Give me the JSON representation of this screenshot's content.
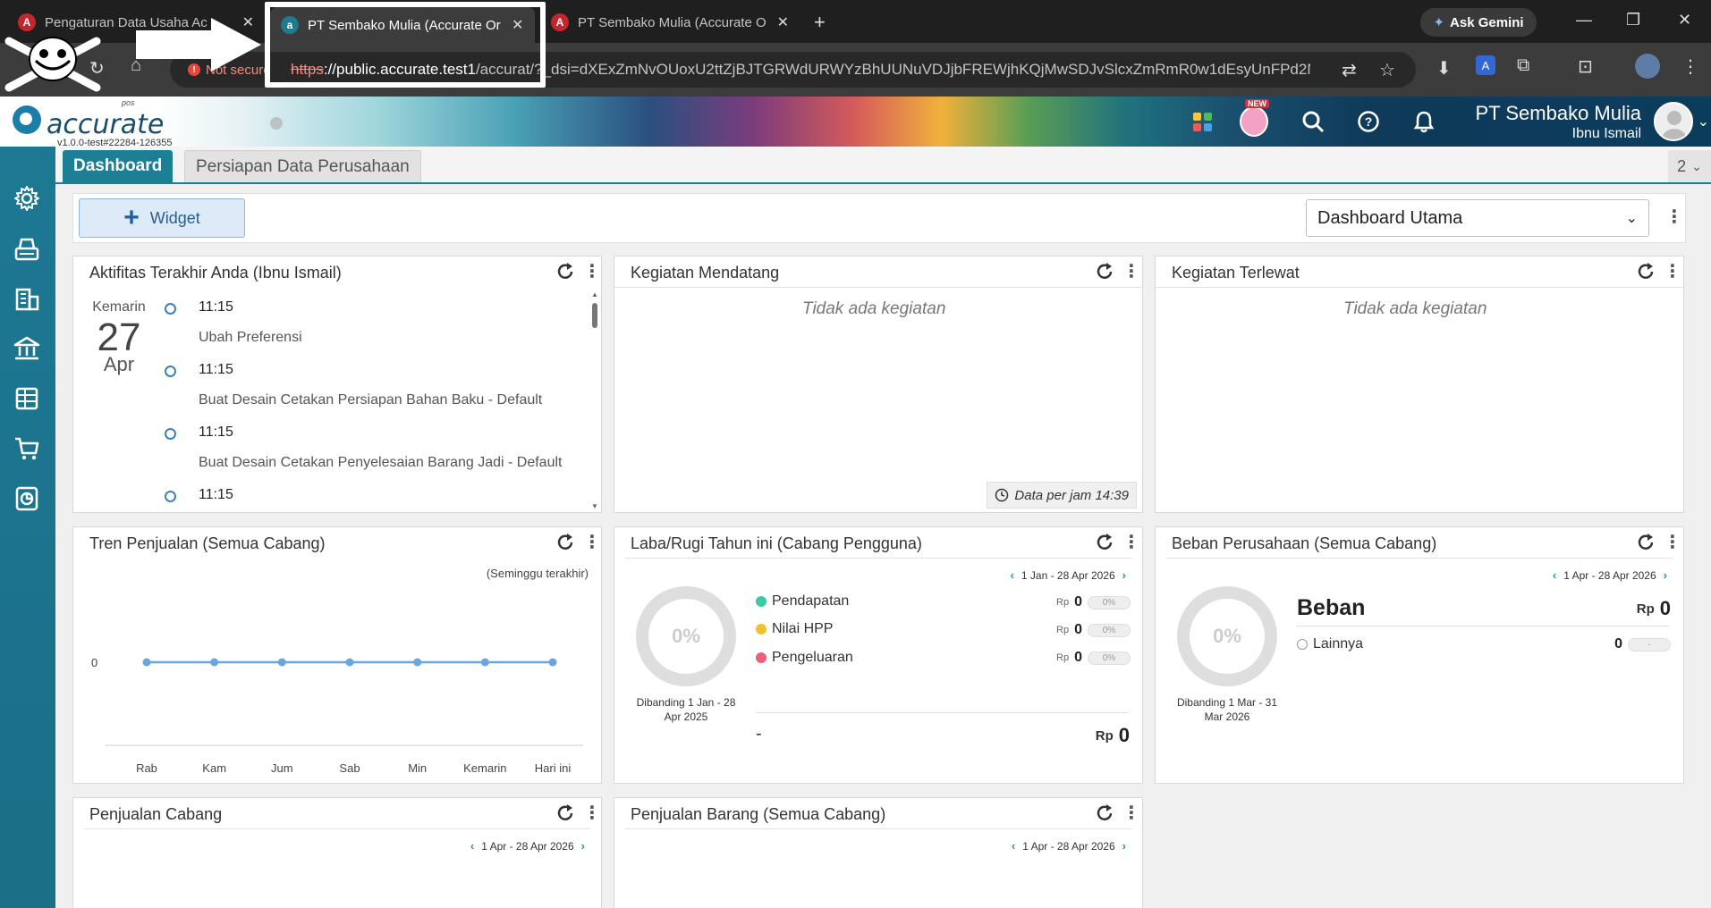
{
  "browser": {
    "tabs": [
      {
        "title": "Pengaturan Data Usaha Ac",
        "active": false
      },
      {
        "title": "PT Sembako Mulia (Accurate Or",
        "active": true
      },
      {
        "title": "PT Sembako Mulia (Accurate O",
        "active": false
      }
    ],
    "new_tab": "+",
    "gemini_label": "Ask Gemini",
    "not_secure": "Not secure",
    "url_scheme": "https",
    "url_host": "://public.accurate.test1",
    "url_rest": "/accurat/?_dsi=dXExZmNvOUoxU2ttZjBJTGRWdURWYzBhUUNuVDJjbFREWjhKQjMwSDJvSlcxZmRmR0w1dEsyUnFPd2Nx..."
  },
  "app": {
    "logo_text": "accurate",
    "logo_pos": "pos",
    "version": "v1.0.0-test#22284-126355",
    "new_badge": "NEW",
    "company_name": "PT Sembako Mulia",
    "user_name": "Ibnu Ismail"
  },
  "tabs": {
    "dashboard": "Dashboard",
    "persiapan": "Persiapan Data Perusahaan",
    "count": "2"
  },
  "toolbar": {
    "widget_label": "Widget",
    "dashboard_select": "Dashboard Utama"
  },
  "activity": {
    "title": "Aktifitas Terakhir Anda (Ibnu Ismail)",
    "day_label": "Kemarin",
    "day_num": "27",
    "month": "Apr",
    "items": [
      {
        "time": "11:15",
        "desc": "Ubah Preferensi"
      },
      {
        "time": "11:15",
        "desc": "Buat Desain Cetakan Persiapan Bahan Baku - Default"
      },
      {
        "time": "11:15",
        "desc": "Buat Desain Cetakan Penyelesaian Barang Jadi - Default"
      },
      {
        "time": "11:15",
        "desc": ""
      }
    ]
  },
  "upcoming": {
    "title": "Kegiatan Mendatang",
    "empty": "Tidak ada kegiatan",
    "data_stamp": "Data per jam 14:39"
  },
  "missed": {
    "title": "Kegiatan Terlewat",
    "empty": "Tidak ada kegiatan"
  },
  "sales_trend": {
    "title": "Tren Penjualan (Semua Cabang)",
    "period": "(Seminggu terakhir)",
    "y_tick": "0"
  },
  "chart_data": {
    "type": "line",
    "title": "Tren Penjualan (Semua Cabang)",
    "categories": [
      "Rab",
      "Kam",
      "Jum",
      "Sab",
      "Min",
      "Kemarin",
      "Hari ini"
    ],
    "series": [
      {
        "values": [
          0,
          0,
          0,
          0,
          0,
          0,
          0
        ]
      }
    ],
    "ylabel": "",
    "xlabel": "",
    "line_color": "#6aa6dd"
  },
  "profit_loss": {
    "title": "Laba/Rugi Tahun ini (Cabang Pengguna)",
    "date_range": "1 Jan - 28 Apr 2026",
    "donut_pct": "0%",
    "compare": "Dibanding 1 Jan - 28 Apr 2025",
    "rows": [
      {
        "label": "Pendapatan",
        "color": "#3ec9a7",
        "currency": "Rp",
        "value": "0",
        "pct": "0%"
      },
      {
        "label": "Nilai HPP",
        "color": "#f2c12e",
        "currency": "Rp",
        "value": "0",
        "pct": "0%"
      },
      {
        "label": "Pengeluaran",
        "color": "#ef5f7a",
        "currency": "Rp",
        "value": "0",
        "pct": "0%"
      }
    ],
    "total_label": "-",
    "total_currency": "Rp",
    "total_value": "0"
  },
  "expenses": {
    "title": "Beban Perusahaan (Semua Cabang)",
    "date_range": "1 Apr - 28 Apr 2026",
    "donut_pct": "0%",
    "compare": "Dibanding 1 Mar - 31 Mar 2026",
    "heading": "Beban",
    "currency": "Rp",
    "total": "0",
    "row_label": "Lainnya",
    "row_value": "0",
    "row_pill": "-"
  },
  "branch_sales": {
    "title": "Penjualan Cabang",
    "date_range": "1 Apr - 28 Apr 2026"
  },
  "item_sales": {
    "title": "Penjualan Barang (Semua Cabang)",
    "date_range": "1 Apr - 28 Apr 2026"
  }
}
